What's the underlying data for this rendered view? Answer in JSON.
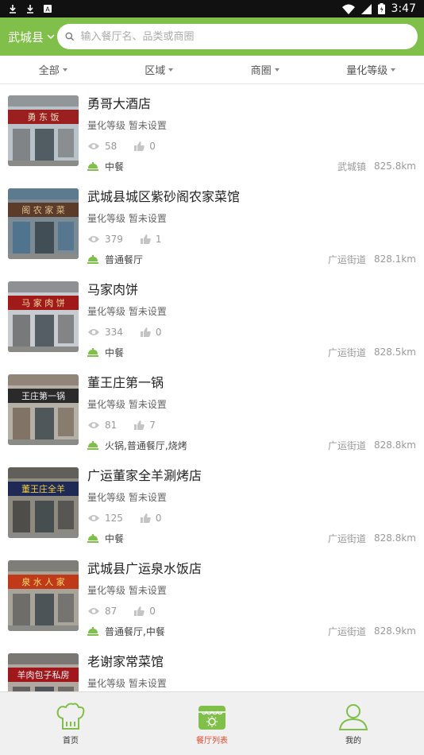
{
  "status": {
    "time": "3:47",
    "icons": [
      "download-icon",
      "download-icon",
      "notification-a-icon",
      "wifi-icon",
      "signal-icon",
      "battery-icon"
    ]
  },
  "header": {
    "city": "武城县",
    "search_placeholder": "输入餐厅名、品类或商圈"
  },
  "filters": [
    {
      "label": "全部"
    },
    {
      "label": "区域"
    },
    {
      "label": "商圈"
    },
    {
      "label": "量化等级"
    }
  ],
  "restaurants": [
    {
      "name": "勇哥大酒店",
      "grade_label": "量化等级",
      "grade_value": "暂未设置",
      "views": "58",
      "likes": "0",
      "category": "中餐",
      "location": "武城镇",
      "distance": "825.8km",
      "thumb_text": "勇 东 饭"
    },
    {
      "name": "武城县城区紫砂阁农家菜馆",
      "grade_label": "量化等级",
      "grade_value": "暂未设置",
      "views": "379",
      "likes": "1",
      "category": "普通餐厅",
      "location": "广运街道",
      "distance": "828.1km",
      "thumb_text": "阁 农 家 菜"
    },
    {
      "name": "马家肉饼",
      "grade_label": "量化等级",
      "grade_value": "暂未设置",
      "views": "334",
      "likes": "0",
      "category": "中餐",
      "location": "广运街道",
      "distance": "828.5km",
      "thumb_text": "马 家 肉 饼"
    },
    {
      "name": "董王庄第一锅",
      "grade_label": "量化等级",
      "grade_value": "暂未设置",
      "views": "81",
      "likes": "7",
      "category": "火锅,普通餐厅,烧烤",
      "location": "广运街道",
      "distance": "828.8km",
      "thumb_text": "王庄第一锅"
    },
    {
      "name": "广运董家全羊涮烤店",
      "grade_label": "量化等级",
      "grade_value": "暂未设置",
      "views": "125",
      "likes": "0",
      "category": "中餐",
      "location": "广运街道",
      "distance": "828.8km",
      "thumb_text": "董王庄全羊"
    },
    {
      "name": "武城县广运泉水饭店",
      "grade_label": "量化等级",
      "grade_value": "暂未设置",
      "views": "87",
      "likes": "0",
      "category": "普通餐厅,中餐",
      "location": "广运街道",
      "distance": "828.9km",
      "thumb_text": "泉 水 人 家"
    },
    {
      "name": "老谢家常菜馆",
      "grade_label": "量化等级",
      "grade_value": "暂未设置",
      "views": "",
      "likes": "",
      "category": "",
      "location": "",
      "distance": "",
      "thumb_text": "羊肉包子私房"
    }
  ],
  "tabbar": [
    {
      "label": "首页",
      "icon": "chef-hat-icon",
      "active": false
    },
    {
      "label": "餐厅列表",
      "icon": "storefront-icon",
      "active": true
    },
    {
      "label": "我的",
      "icon": "user-icon",
      "active": false
    }
  ],
  "colors": {
    "brand_green": "#80c04a",
    "active_tab": "#e54a2e"
  }
}
